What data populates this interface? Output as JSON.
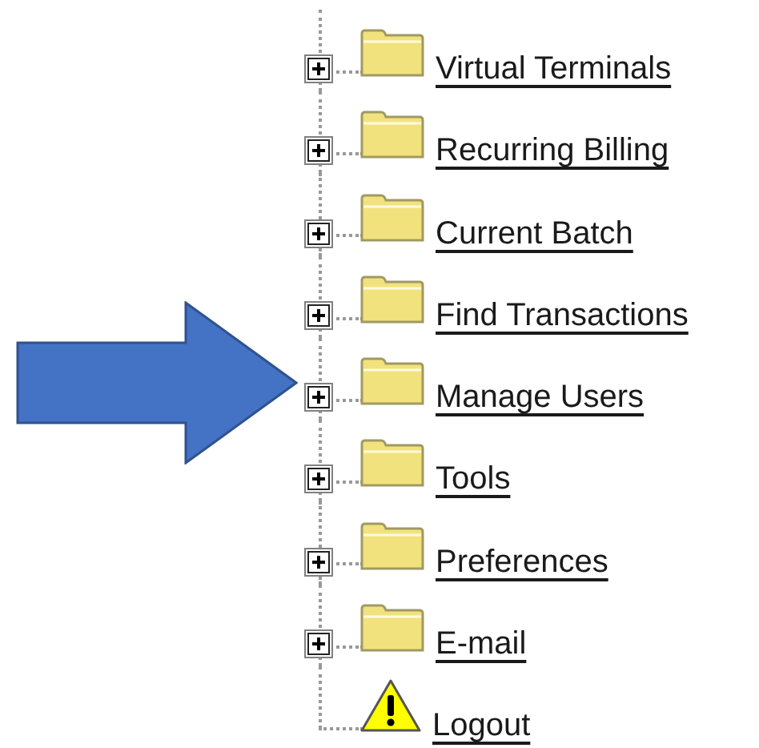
{
  "tree": {
    "items": [
      {
        "kind": "folder",
        "label": "Virtual Terminals",
        "expanded": false
      },
      {
        "kind": "folder",
        "label": "Recurring Billing",
        "expanded": false
      },
      {
        "kind": "folder",
        "label": "Current Batch",
        "expanded": false
      },
      {
        "kind": "folder",
        "label": "Find Transactions",
        "expanded": false
      },
      {
        "kind": "folder",
        "label": "Manage Users",
        "expanded": false
      },
      {
        "kind": "folder",
        "label": "Tools",
        "expanded": false
      },
      {
        "kind": "folder",
        "label": "Preferences",
        "expanded": false
      },
      {
        "kind": "folder",
        "label": "E-mail",
        "expanded": false
      },
      {
        "kind": "warning",
        "label": "Logout"
      }
    ]
  }
}
